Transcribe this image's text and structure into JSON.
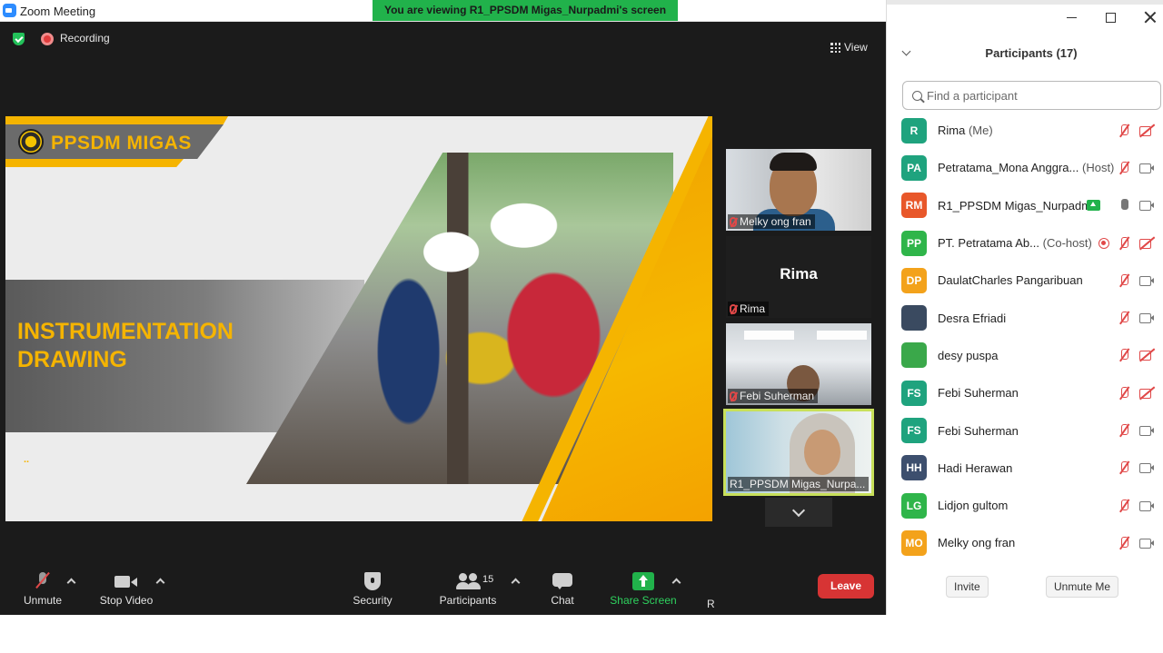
{
  "window": {
    "title": "Zoom Meeting"
  },
  "banner": {
    "viewing_text": "You are viewing R1_PPSDM Migas_Nurpadmi's screen"
  },
  "status": {
    "recording_label": "Recording",
    "view_label": "View"
  },
  "slide": {
    "brand": "PPSDM MIGAS",
    "title_line1": "INSTRUMENTATION",
    "title_line2": "DRAWING",
    "dots": ".."
  },
  "video_tiles": [
    {
      "name": "Melky ong fran"
    },
    {
      "name": "Rima",
      "display_name": "Rima"
    },
    {
      "name": "Febi Suherman"
    },
    {
      "name": "R1_PPSDM Migas_Nurpa..."
    }
  ],
  "toolbar": {
    "unmute": "Unmute",
    "stop_video": "Stop Video",
    "security": "Security",
    "participants": "Participants",
    "participants_count": "15",
    "chat": "Chat",
    "share_screen": "Share Screen",
    "record_cut": "R",
    "leave": "Leave"
  },
  "panel": {
    "title": "Participants (17)",
    "search_placeholder": "Find a participant",
    "invite": "Invite",
    "unmute_me": "Unmute Me",
    "participants": [
      {
        "initials": "R",
        "color": "#1fa37e",
        "name": "Rima",
        "tag": "(Me)",
        "mic": "mic-off-icon",
        "cam": "cam-off-icon"
      },
      {
        "initials": "PA",
        "color": "#1fa37e",
        "name": "Petratama_Mona Anggra...",
        "tag": "(Host)",
        "mic": "mic-off-icon",
        "cam": "cam-icon"
      },
      {
        "initials": "RM",
        "color": "#e8572a",
        "name": "R1_PPSDM Migas_Nurpadmi",
        "tag": "",
        "mic": "mic-icon",
        "cam": "cam-icon"
      },
      {
        "initials": "PP",
        "color": "#2fb54a",
        "name": "PT. Petratama Ab...",
        "tag": "(Co-host)",
        "mic": "mic-off-icon",
        "cam": "cam-off-icon"
      },
      {
        "initials": "DP",
        "color": "#f3a21b",
        "name": "DaulatCharles Pangaribuan",
        "tag": "",
        "mic": "mic-off-icon",
        "cam": "cam-icon"
      },
      {
        "initials": "",
        "color": "#3a4a60",
        "name": "Desra Efriadi",
        "tag": "",
        "mic": "mic-off-icon",
        "cam": "cam-icon"
      },
      {
        "initials": "",
        "color": "#3aa84a",
        "name": "desy puspa",
        "tag": "",
        "mic": "mic-off-icon",
        "cam": "cam-off-icon"
      },
      {
        "initials": "FS",
        "color": "#1fa37e",
        "name": "Febi Suherman",
        "tag": "",
        "mic": "mic-off-icon",
        "cam": "cam-off-icon"
      },
      {
        "initials": "FS",
        "color": "#1fa37e",
        "name": "Febi Suherman",
        "tag": "",
        "mic": "mic-off-icon",
        "cam": "cam-icon"
      },
      {
        "initials": "HH",
        "color": "#3d4f6e",
        "name": "Hadi Herawan",
        "tag": "",
        "mic": "mic-off-icon",
        "cam": "cam-icon"
      },
      {
        "initials": "LG",
        "color": "#2fb54a",
        "name": "Lidjon gultom",
        "tag": "",
        "mic": "mic-off-icon",
        "cam": "cam-icon"
      },
      {
        "initials": "MO",
        "color": "#f3a21b",
        "name": "Melky ong fran",
        "tag": "",
        "mic": "mic-off-icon",
        "cam": "cam-icon"
      }
    ]
  }
}
